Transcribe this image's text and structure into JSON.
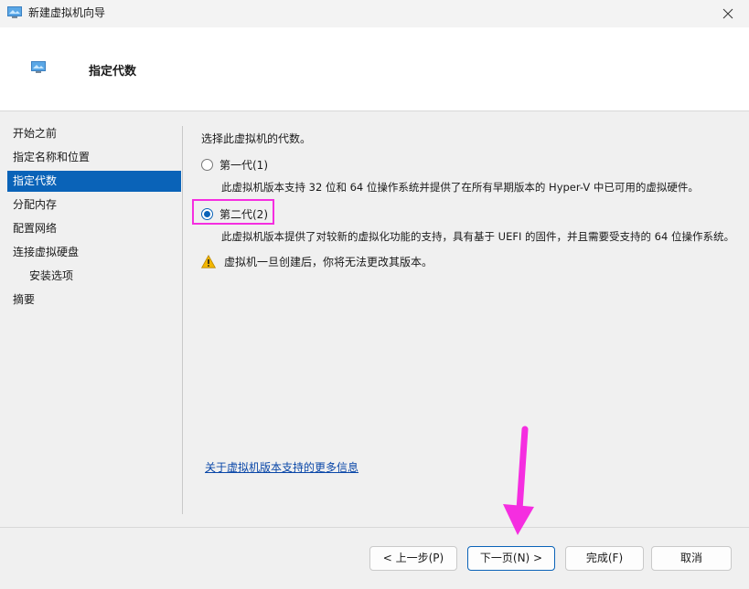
{
  "window": {
    "title": "新建虚拟机向导",
    "close_icon": "close-icon"
  },
  "header": {
    "title": "指定代数"
  },
  "nav": {
    "items": [
      {
        "label": "开始之前",
        "selected": false,
        "sub": false
      },
      {
        "label": "指定名称和位置",
        "selected": false,
        "sub": false
      },
      {
        "label": "指定代数",
        "selected": true,
        "sub": false
      },
      {
        "label": "分配内存",
        "selected": false,
        "sub": false
      },
      {
        "label": "配置网络",
        "selected": false,
        "sub": false
      },
      {
        "label": "连接虚拟硬盘",
        "selected": false,
        "sub": false
      },
      {
        "label": "安装选项",
        "selected": false,
        "sub": true
      },
      {
        "label": "摘要",
        "selected": false,
        "sub": false
      }
    ]
  },
  "main": {
    "prompt": "选择此虚拟机的代数。",
    "gen1": {
      "label": "第一代(1)",
      "checked": false,
      "description": "此虚拟机版本支持 32 位和 64 位操作系统并提供了在所有早期版本的 Hyper-V 中已可用的虚拟硬件。"
    },
    "gen2": {
      "label": "第二代(2)",
      "checked": true,
      "description": "此虚拟机版本提供了对较新的虚拟化功能的支持，具有基于 UEFI 的固件，并且需要受支持的 64 位操作系统。"
    },
    "warning": "虚拟机一旦创建后，你将无法更改其版本。",
    "more_info_link": "关于虚拟机版本支持的更多信息"
  },
  "footer": {
    "prev_label": "< 上一步(P)",
    "next_label": "下一页(N) >",
    "finish_label": "完成(F)",
    "cancel_label": "取消"
  },
  "colors": {
    "accent": "#0a63b8",
    "annotation": "#f52ee0",
    "warning": "#e0a100"
  }
}
